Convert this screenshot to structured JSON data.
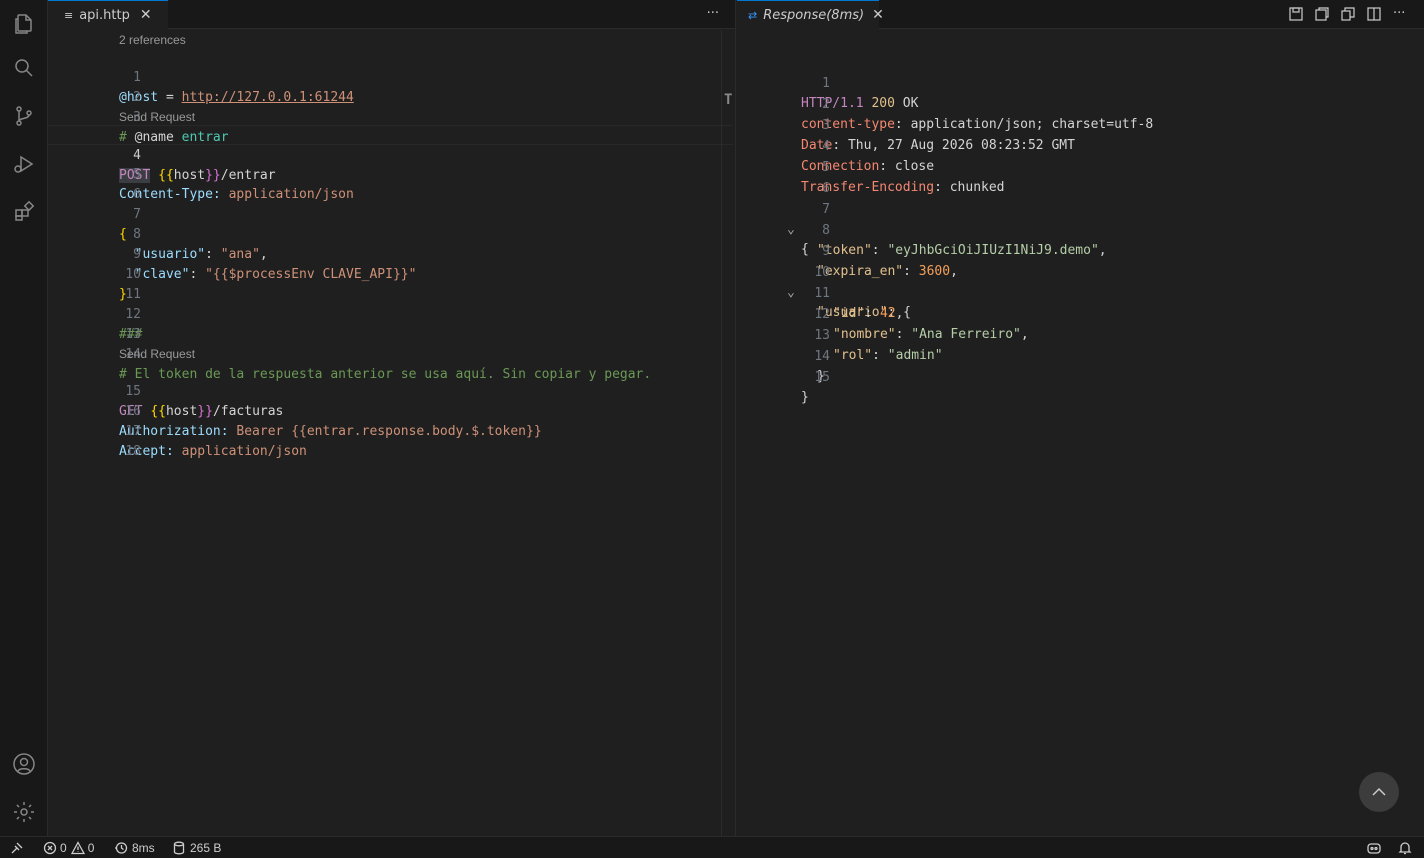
{
  "left_tab": {
    "icon": "≡",
    "label": "api.http",
    "more": "···"
  },
  "right_tab": {
    "icon": "⇄",
    "label": "Response(8ms)",
    "more": "···"
  },
  "lens": {
    "references": "2 references",
    "send1": "Send Request",
    "send2": "Send Request"
  },
  "request_lines": {
    "n": [
      "1",
      "2",
      "3",
      "4",
      "5",
      "6",
      "7",
      "8",
      "9",
      "10",
      "11",
      "12",
      "13",
      "14",
      "15",
      "16",
      "17",
      "18"
    ],
    "l1": {
      "var": "@host",
      "eq": " = ",
      "url": "http://127.0.0.1:61244"
    },
    "l3": {
      "hash": "# ",
      "name_kw": "@name",
      "name_val": " entrar"
    },
    "l4": {
      "method": "POST",
      "sp": " ",
      "open": "{{",
      "var": "host",
      "close": "}}",
      "path": "/entrar"
    },
    "l5": {
      "key": "Content-Type:",
      "val": " application/json"
    },
    "l7": {
      "brace": "{"
    },
    "l8": {
      "indent": "  ",
      "key": "\"usuario\"",
      "sep": ": ",
      "val": "\"ana\"",
      "end": ","
    },
    "l9": {
      "indent": "  ",
      "key": "\"clave\"",
      "sep": ": ",
      "val": "\"{{$processEnv CLAVE_API}}\""
    },
    "l10": {
      "brace": "}"
    },
    "l12": {
      "sep": "###"
    },
    "l14": {
      "comment": "# El token de la respuesta anterior se usa aquí. Sin copiar y pegar."
    },
    "l15": {
      "method": "GET",
      "sp": " ",
      "open": "{{",
      "var": "host",
      "close": "}}",
      "path": "/facturas"
    },
    "l16": {
      "key": "Authorization:",
      "val": " Bearer {{entrar.response.body.$.token}}"
    },
    "l17": {
      "key": "Accept:",
      "val": " application/json"
    }
  },
  "response_lines": {
    "n": [
      "1",
      "2",
      "3",
      "4",
      "5",
      "6",
      "7",
      "8",
      "9",
      "10",
      "11",
      "12",
      "13",
      "14",
      "15"
    ],
    "l1": {
      "proto": "HTTP/1.1",
      "code": " 200",
      "text": " OK"
    },
    "l2": {
      "key": "content-type",
      "val": ": application/json; charset=utf-8"
    },
    "l3": {
      "key": "Date",
      "val": ": Thu, 27 Aug 2026 08:23:52 GMT"
    },
    "l4": {
      "key": "Connection",
      "val": ": close"
    },
    "l5": {
      "key": "Transfer-Encoding",
      "val": ": chunked"
    },
    "l7": {
      "brace": "{"
    },
    "l8": {
      "key": "\"token\"",
      "sep": ": ",
      "val": "\"eyJhbGciOiJIUzI1NiJ9.demo\"",
      "end": ","
    },
    "l9": {
      "key": "\"expira_en\"",
      "sep": ": ",
      "val": "3600",
      "end": ","
    },
    "l10": {
      "key": "\"usuario\"",
      "sep": ": ",
      "brace": "{"
    },
    "l11": {
      "key": "\"id\"",
      "sep": ": ",
      "val": "42",
      "end": ","
    },
    "l12": {
      "key": "\"nombre\"",
      "sep": ": ",
      "val": "\"Ana Ferreiro\"",
      "end": ","
    },
    "l13": {
      "key": "\"rol\"",
      "sep": ": ",
      "val": "\"admin\""
    },
    "l14": {
      "brace": "}"
    },
    "l15": {
      "brace": "}"
    }
  },
  "status": {
    "errors": "0",
    "warnings": "0",
    "time": "8ms",
    "size": "265 B"
  },
  "colors": {
    "accent": "#0078d4",
    "background": "#1f1f1f"
  }
}
